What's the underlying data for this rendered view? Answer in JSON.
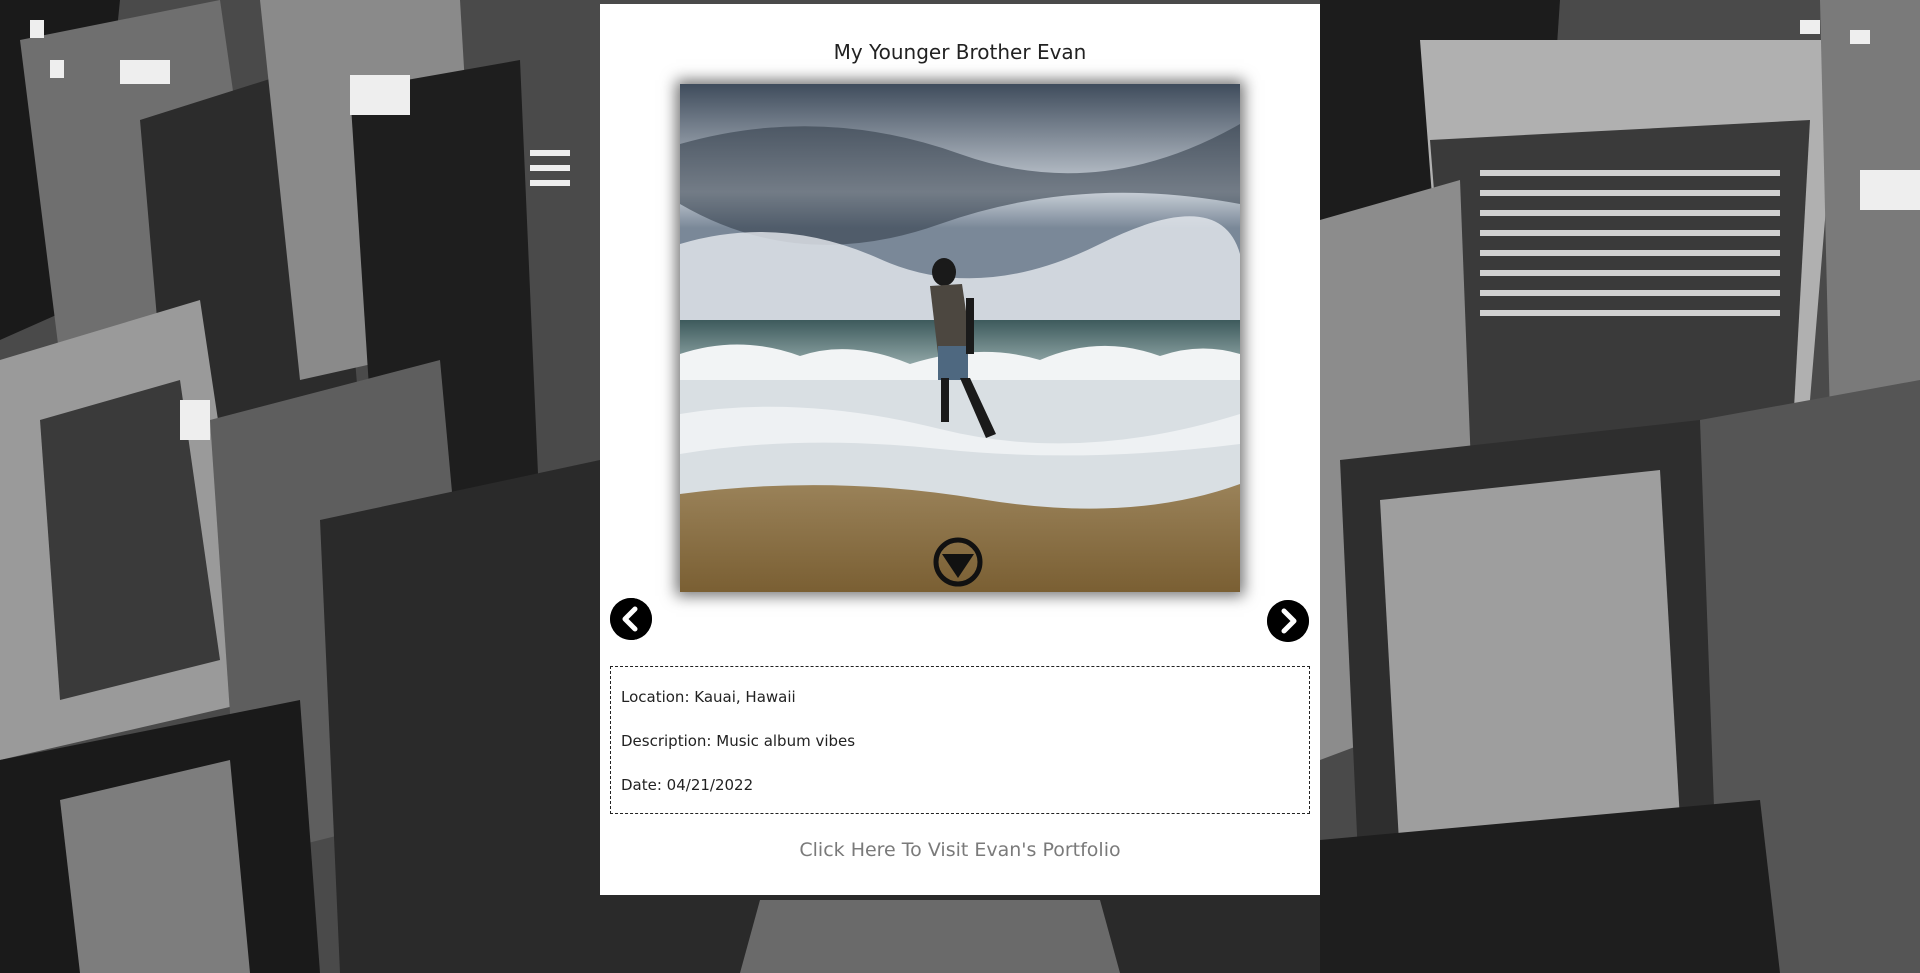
{
  "post": {
    "title": "My Younger Brother Evan",
    "location": "Location: Kauai, Hawaii",
    "description": "Description: Music album vibes",
    "date": "Date: 04/21/2022",
    "portfolio_link": "Click Here To Visit Evan's Portfolio"
  },
  "icons": {
    "prev": "chevron-left-icon",
    "next": "chevron-right-icon",
    "down": "triangle-down-circle-icon"
  },
  "colors": {
    "card_bg": "#ffffff",
    "text": "#222222",
    "link": "#7a7a7a",
    "nav_button": "#000000"
  }
}
